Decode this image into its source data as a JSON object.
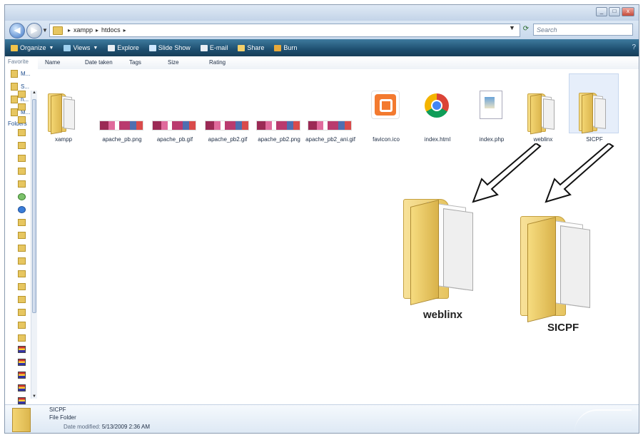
{
  "window": {
    "controls": {
      "minimize": "_",
      "maximize": "□",
      "close": "x"
    }
  },
  "address": {
    "back_icon": "back-arrow-icon",
    "forward_icon": "forward-arrow-icon",
    "crumbs": [
      "xampp",
      "htdocs"
    ],
    "search_placeholder": "Search"
  },
  "toolbar": {
    "items": [
      {
        "label": "Organize",
        "icon_color": "#f1c34a",
        "dropdown": true
      },
      {
        "label": "Views",
        "icon_color": "#9fd1f0",
        "dropdown": true
      },
      {
        "label": "Explore",
        "icon_color": "#e9eef4",
        "dropdown": false
      },
      {
        "label": "Slide Show",
        "icon_color": "#cfe7ff",
        "dropdown": false
      },
      {
        "label": "E-mail",
        "icon_color": "#e9eef4",
        "dropdown": false
      },
      {
        "label": "Share",
        "icon_color": "#f3d06a",
        "dropdown": false
      },
      {
        "label": "Burn",
        "icon_color": "#e8a93a",
        "dropdown": false
      }
    ],
    "help": "?"
  },
  "navpane": {
    "favorites_label": "Favorite",
    "favorites": [
      "M...",
      "S...",
      "h...",
      "M..."
    ],
    "folders_label": "Folders"
  },
  "columns": [
    "Name",
    "Date taken",
    "Tags",
    "Size",
    "Rating"
  ],
  "files": [
    {
      "name": "xampp",
      "kind": "folder"
    },
    {
      "name": "apache_pb.png",
      "kind": "image"
    },
    {
      "name": "apache_pb.gif",
      "kind": "image"
    },
    {
      "name": "apache_pb2.gif",
      "kind": "image"
    },
    {
      "name": "apache_pb2.png",
      "kind": "image"
    },
    {
      "name": "apache_pb2_ani.gif",
      "kind": "image"
    },
    {
      "name": "favicon.ico",
      "kind": "xampp-icon"
    },
    {
      "name": "index.html",
      "kind": "chrome-icon"
    },
    {
      "name": "index.php",
      "kind": "php-doc"
    },
    {
      "name": "weblinx",
      "kind": "folder"
    },
    {
      "name": "SICPF",
      "kind": "folder",
      "selected": true
    }
  ],
  "callouts": [
    {
      "label": "weblinx"
    },
    {
      "label": "SICPF"
    }
  ],
  "details": {
    "name": "SICPF",
    "type": "File Folder",
    "modified_label": "Date modified:",
    "modified_value": "5/13/2009 2:36 AM"
  }
}
